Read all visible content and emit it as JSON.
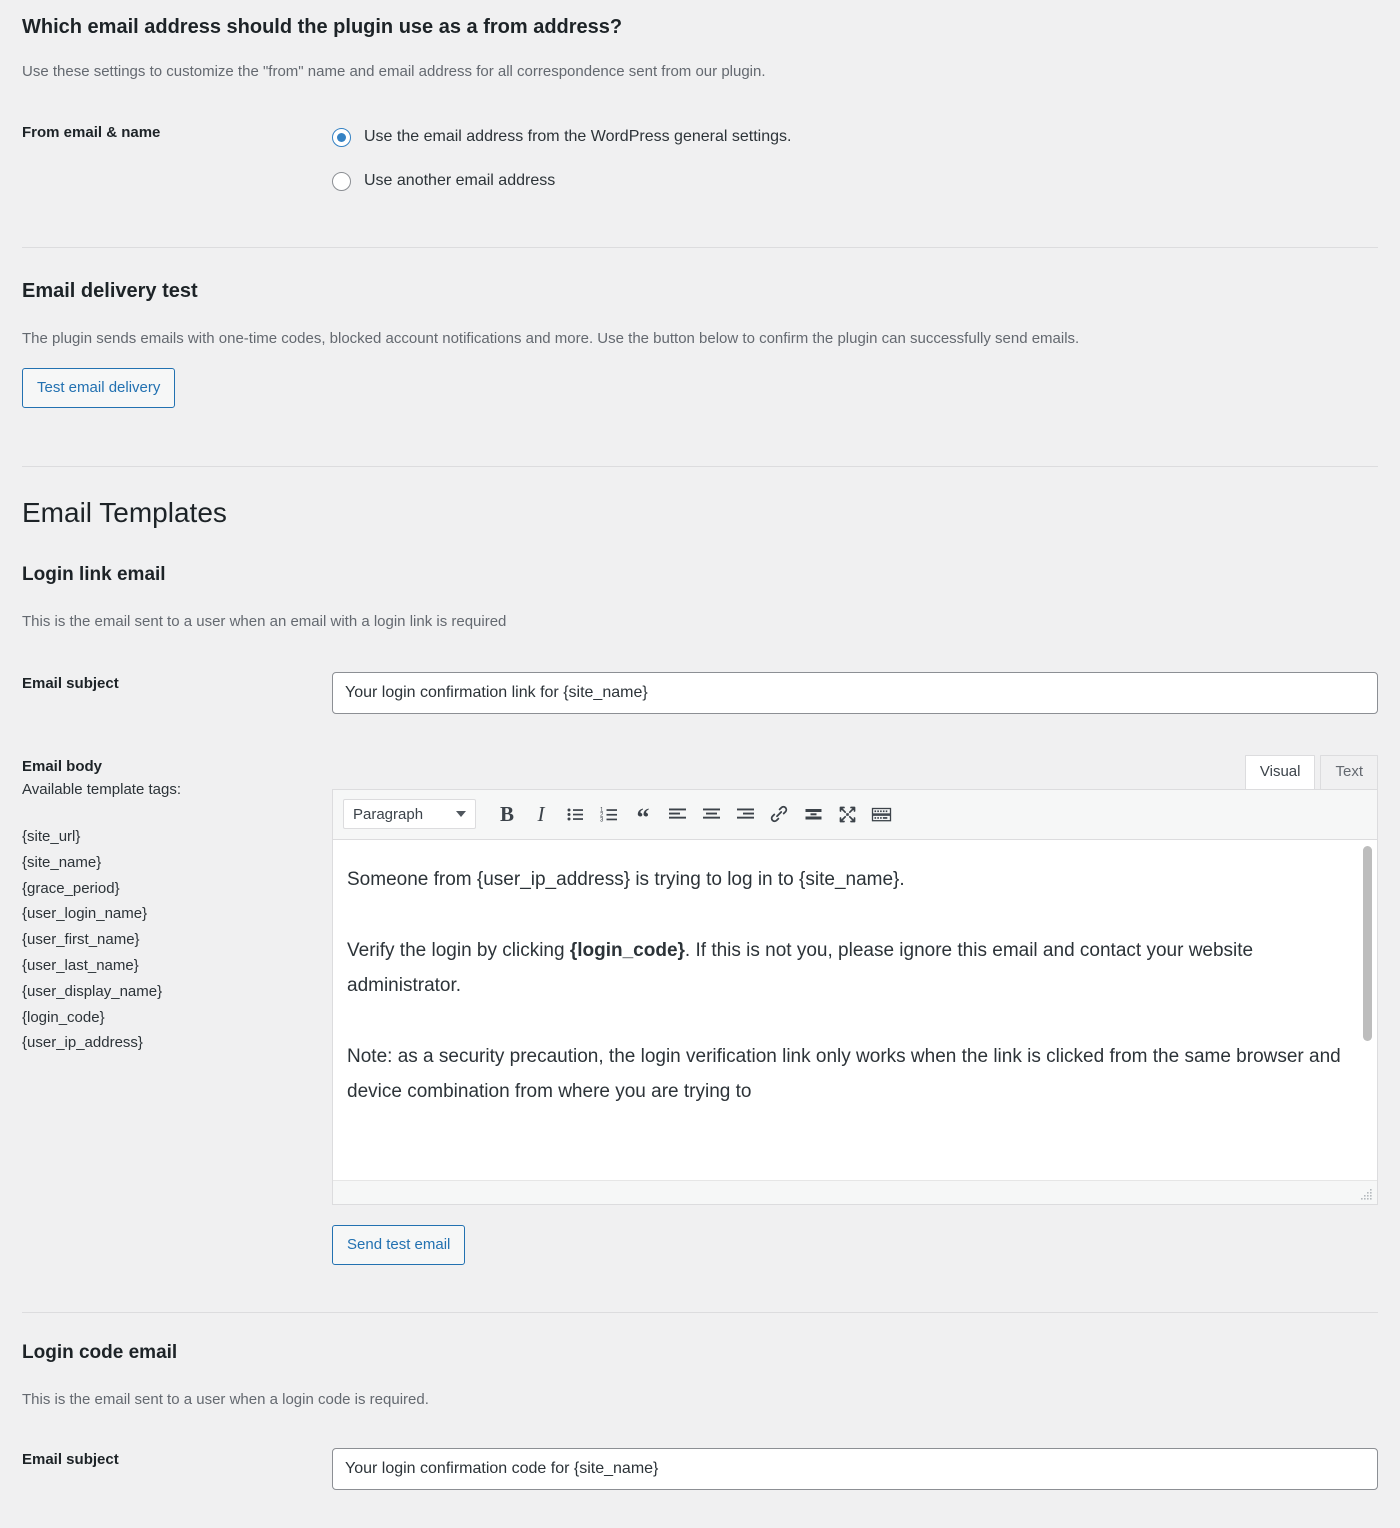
{
  "from_section": {
    "heading": "Which email address should the plugin use as a from address?",
    "description": "Use these settings to customize the \"from\" name and email address for all correspondence sent from our plugin.",
    "field_label": "From email & name",
    "options": [
      {
        "label": "Use the email address from the WordPress general settings.",
        "checked": true
      },
      {
        "label": "Use another email address",
        "checked": false
      }
    ]
  },
  "delivery_test": {
    "heading": "Email delivery test",
    "description": "The plugin sends emails with one-time codes, blocked account notifications and more. Use the button below to confirm the plugin can successfully send emails.",
    "button_label": "Test email delivery"
  },
  "templates": {
    "heading": "Email Templates",
    "login_link": {
      "heading": "Login link email",
      "description": "This is the email sent to a user when an email with a login link is required",
      "subject_label": "Email subject",
      "subject_value": "Your login confirmation link for {site_name}",
      "body_label": "Email body",
      "tags_label": "Available template tags:",
      "tags": [
        "{site_url}",
        "{site_name}",
        "{grace_period}",
        "{user_login_name}",
        "{user_first_name}",
        "{user_last_name}",
        "{user_display_name}",
        "{login_code}",
        "{user_ip_address}"
      ],
      "editor": {
        "tabs": [
          {
            "label": "Visual",
            "active": true
          },
          {
            "label": "Text",
            "active": false
          }
        ],
        "format_select": "Paragraph",
        "toolbar_buttons": [
          "bold-icon",
          "italic-icon",
          "bulleted-list-icon",
          "numbered-list-icon",
          "blockquote-icon",
          "align-left-icon",
          "align-center-icon",
          "align-right-icon",
          "link-icon",
          "insert-read-more-icon",
          "distraction-free-icon",
          "keyboard-shortcuts-icon"
        ],
        "body_paragraphs": [
          {
            "before": "Someone from {user_ip_address} is trying to log in to {site_name}.",
            "bold": "",
            "after": ""
          },
          {
            "before": "Verify the login by clicking ",
            "bold": "{login_code}",
            "after": ". If this is not you, please ignore this email and contact your website administrator."
          },
          {
            "before": "Note: as a security precaution, the login verification link only works when the link is clicked from the same browser and device combination from where you are trying to",
            "bold": "",
            "after": ""
          }
        ]
      },
      "send_test_label": "Send test email"
    },
    "login_code": {
      "heading": "Login code email",
      "description": "This is the email sent to a user when a login code is required.",
      "subject_label": "Email subject",
      "subject_value": "Your login confirmation code for {site_name}"
    }
  },
  "colors": {
    "page_background": "#f0f0f1",
    "accent_blue": "#2271b1",
    "radio_blue": "#3582c4",
    "text": "#1d2327",
    "muted_text": "#646970",
    "border": "#dcdcde"
  }
}
